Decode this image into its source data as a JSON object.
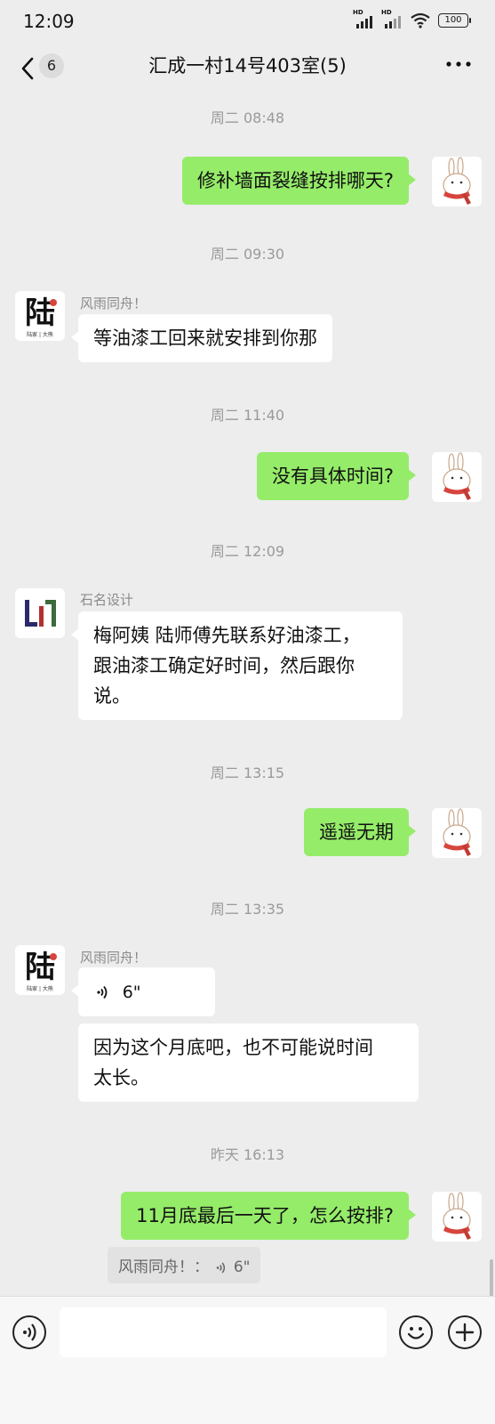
{
  "status_bar": {
    "time": "12:09",
    "signal1_label": "HD",
    "signal2_label": "HD",
    "battery": "100"
  },
  "header": {
    "unread_count": "6",
    "title": "汇成一村14号403室(5)"
  },
  "messages": {
    "ts1": "周二 08:48",
    "m1": "修补墙面裂缝按排哪天?",
    "ts2": "周二 09:30",
    "m2_sender": "风雨同舟！",
    "m2": "等油漆工回来就安排到你那",
    "ts3": "周二 11:40",
    "m3": "没有具体时间?",
    "ts4": "周二 12:09",
    "m4_sender": "石名设计",
    "m4_line1": "梅阿姨  陆师傅先联系好油漆工，",
    "m4_line2": "跟油漆工确定好时间，然后跟你",
    "m4_line3": "说。",
    "ts5": "周二 13:15",
    "m5": "遥遥无期",
    "ts6": "周二 13:35",
    "m6_sender": "风雨同舟！",
    "m6_voice": "6\"",
    "m7_line1": "因为这个月底吧，也不可能说时间",
    "m7_line2": "太长。",
    "ts7": "昨天 16:13",
    "m8": "11月底最后一天了，怎么按排?",
    "quote_prefix": "风雨同舟！：",
    "quote_voice": "6\""
  },
  "avatars": {
    "lu_char": "陆",
    "lu_caption": "陆家 | 大熊",
    "shiming_mark": "LI7"
  },
  "input": {
    "value": ""
  },
  "colors": {
    "my_bubble": "#95ec69",
    "other_bubble": "#ffffff",
    "background": "#ededed"
  }
}
